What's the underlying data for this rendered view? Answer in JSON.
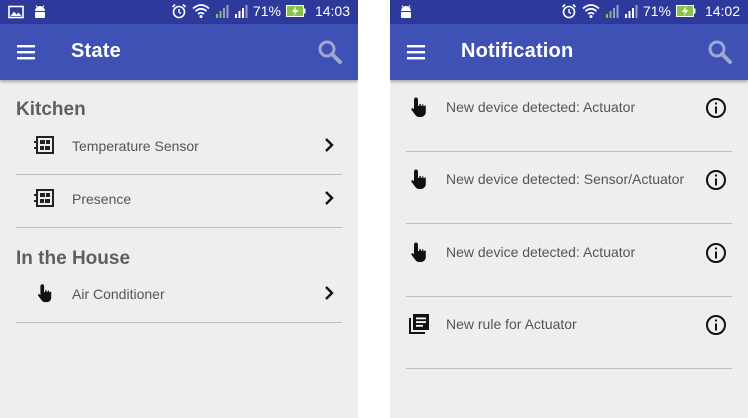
{
  "status_bar_left": {
    "time": "14:03",
    "battery": "71%"
  },
  "status_bar_right": {
    "time": "14:02",
    "battery": "71%"
  },
  "state_screen": {
    "title": "State",
    "sections": [
      {
        "title": "Kitchen",
        "items": [
          {
            "label": "Temperature Sensor",
            "icon": "sensor-icon"
          },
          {
            "label": "Presence",
            "icon": "sensor-icon"
          }
        ]
      },
      {
        "title": "In the House",
        "items": [
          {
            "label": "Air Conditioner",
            "icon": "touch-icon"
          }
        ]
      }
    ]
  },
  "notification_screen": {
    "title": "Notification",
    "items": [
      {
        "label": "New device detected: Actuator",
        "icon": "touch-icon"
      },
      {
        "label": "New device detected: Sensor/Actuator",
        "icon": "touch-icon"
      },
      {
        "label": "New device detected: Actuator",
        "icon": "touch-icon"
      },
      {
        "label": "New rule for Actuator",
        "icon": "rule-list-icon"
      }
    ]
  },
  "colors": {
    "app_bar": "#3f51b5",
    "status_bar": "#2d3a9c",
    "background": "#eeeeee",
    "battery_accent": "#8bc34a"
  }
}
